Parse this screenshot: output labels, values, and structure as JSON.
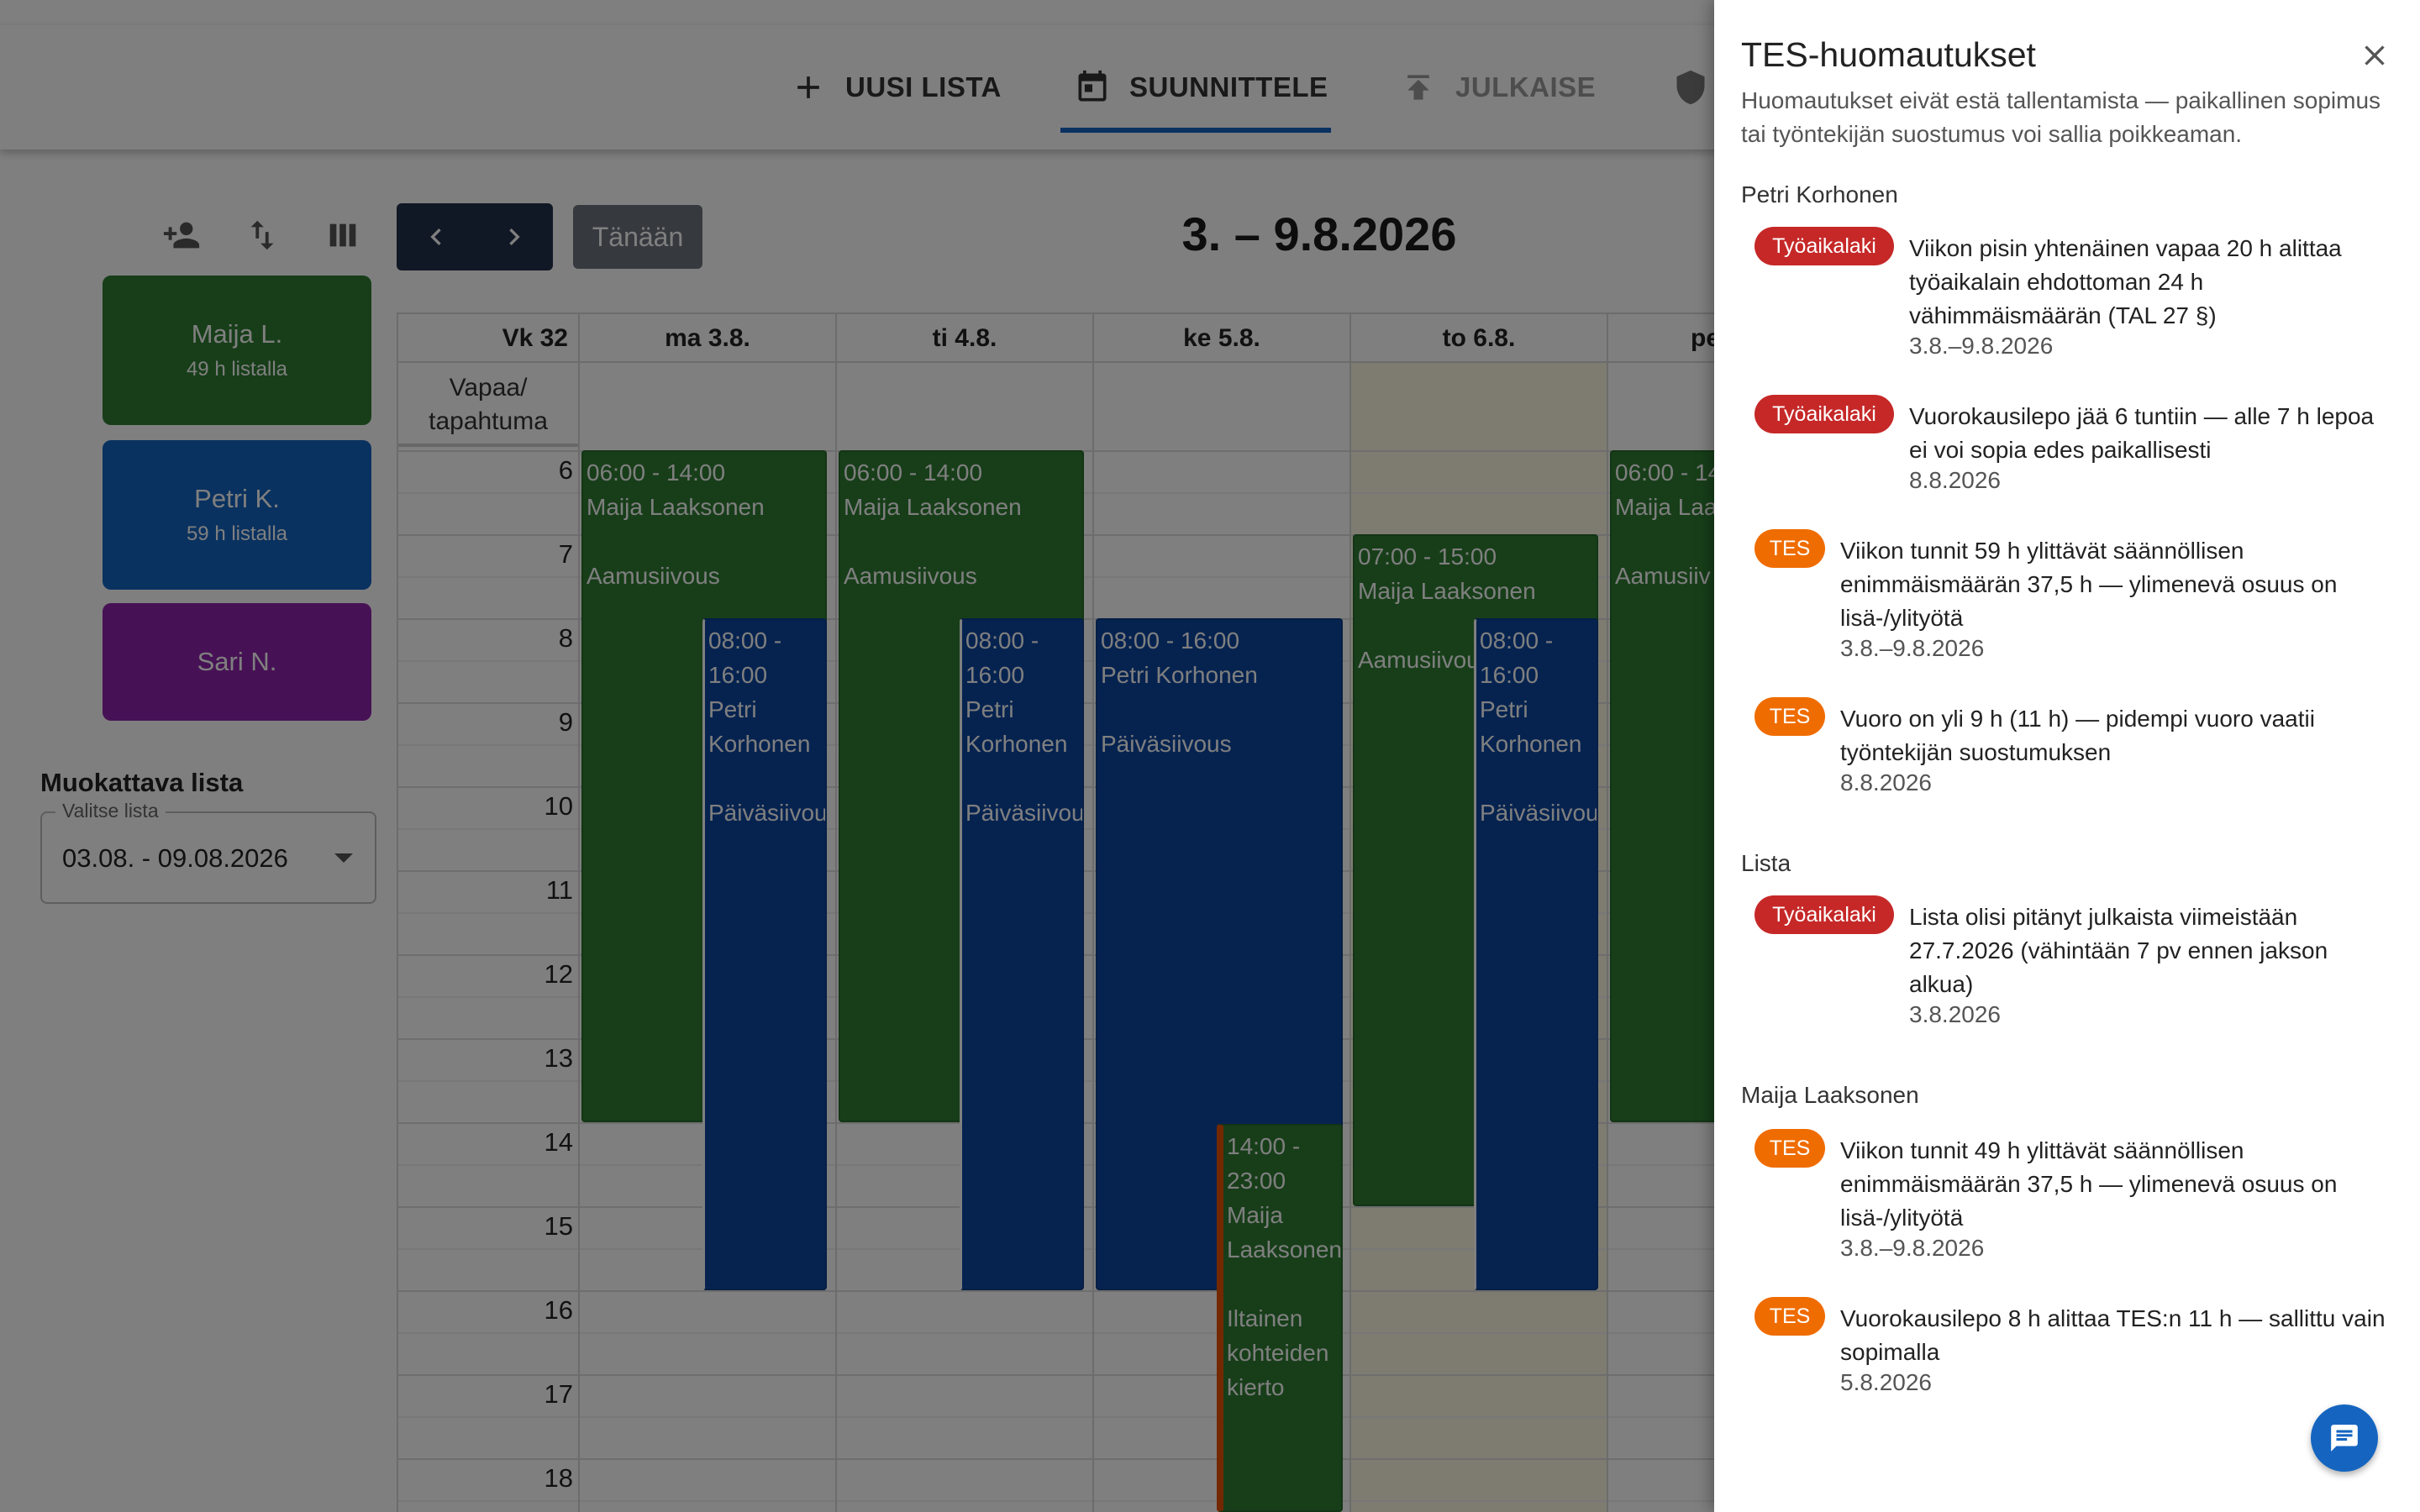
{
  "nav": {
    "new_list": "UUSI LISTA",
    "plan": "SUUNNITTELE",
    "publish": "JULKAISE"
  },
  "toolbar": {
    "today": "Tänään",
    "range_title": "3. – 9.8.2026"
  },
  "employees": [
    {
      "name": "Maija L.",
      "hours": "49 h listalla",
      "color": "#2e7d32"
    },
    {
      "name": "Petri K.",
      "hours": "59 h listalla",
      "color": "#1565c0"
    },
    {
      "name": "Sari N.",
      "hours": "",
      "color": "#8e24aa"
    }
  ],
  "list_select": {
    "label": "Muokattava lista",
    "legend": "Valitse lista",
    "value": "03.08. - 09.08.2026"
  },
  "calendar": {
    "week": "Vk 32",
    "days": [
      "ma 3.8.",
      "ti 4.8.",
      "ke 5.8.",
      "to 6.8.",
      "pe"
    ],
    "allday_label": "Vapaa/ tapahtuma",
    "hours": [
      "6",
      "7",
      "8",
      "9",
      "10",
      "11",
      "12",
      "13",
      "14",
      "15",
      "16",
      "17",
      "18"
    ],
    "events": {
      "mon_maija": {
        "time": "06:00 - 14:00",
        "name": "Maija Laaksonen",
        "type": "Aamusiivous"
      },
      "mon_petri": {
        "time": "08:00 - 16:00",
        "name": "Petri Korhonen",
        "type": "Päiväsiivous"
      },
      "tue_maija": {
        "time": "06:00 - 14:00",
        "name": "Maija Laaksonen",
        "type": "Aamusiivous"
      },
      "tue_petri": {
        "time": "08:00 - 16:00",
        "name": "Petri Korhonen",
        "type": "Päiväsiivous"
      },
      "wed_petri": {
        "time": "08:00 - 16:00",
        "name": "Petri Korhonen",
        "type": "Päiväsiivous"
      },
      "wed_maija": {
        "time": "14:00 - 23:00",
        "name": "Maija Laaksonen",
        "type": "Iltainen kohteiden kierto"
      },
      "thu_maija": {
        "time": "07:00 - 15:00",
        "name": "Maija Laaksonen",
        "type": "Aamusiivous"
      },
      "thu_petri": {
        "time": "08:00 - 16:00",
        "name": "Petri Korhonen",
        "type": "Päiväsiivous"
      },
      "fri_maija": {
        "time": "06:00 - 14",
        "name": "Maija Laa",
        "type": "Aamusiiv"
      }
    }
  },
  "drawer": {
    "title": "TES-huomautukset",
    "subtitle": "Huomautukset eivät estä tallentamista — paikallinen sopimus tai työntekijän suostumus voi sallia poikkeaman.",
    "sections": [
      {
        "label": "Petri Korhonen",
        "notes": [
          {
            "badge": "Työaikalaki",
            "text": "Viikon pisin yhtenäinen vapaa 20 h alittaa työaikalain ehdottoman 24 h vähimmäismäärän (TAL 27 §)",
            "date": "3.8.–9.8.2026"
          },
          {
            "badge": "Työaikalaki",
            "text": "Vuorokausilepo jää 6 tuntiin — alle 7 h lepoa ei voi sopia edes paikallisesti",
            "date": "8.8.2026"
          },
          {
            "badge": "TES",
            "text": "Viikon tunnit 59 h ylittävät säännöllisen enimmäismäärän 37,5 h — ylimenevä osuus on lisä-/ylityötä",
            "date": "3.8.–9.8.2026"
          },
          {
            "badge": "TES",
            "text": "Vuoro on yli 9 h (11 h) — pidempi vuoro vaatii työntekijän suostumuksen",
            "date": "8.8.2026"
          }
        ]
      },
      {
        "label": "Lista",
        "notes": [
          {
            "badge": "Työaikalaki",
            "text": "Lista olisi pitänyt julkaista viimeistään 27.7.2026 (vähintään 7 pv ennen jakson alkua)",
            "date": "3.8.2026"
          }
        ]
      },
      {
        "label": "Maija Laaksonen",
        "notes": [
          {
            "badge": "TES",
            "text": "Viikon tunnit 49 h ylittävät säännöllisen enimmäismäärän 37,5 h — ylimenevä osuus on lisä-/ylityötä",
            "date": "3.8.–9.8.2026"
          },
          {
            "badge": "TES",
            "text": "Vuorokausilepo 8 h alittaa TES:n 11 h — sallittu vain sopimalla",
            "date": "5.8.2026"
          }
        ]
      }
    ]
  },
  "colors": {
    "law_badge": "#c62828",
    "tes_badge": "#ef6c00",
    "accent": "#1565c0",
    "shift_green": "#2e7d32",
    "shift_blue": "#0d47a1"
  }
}
